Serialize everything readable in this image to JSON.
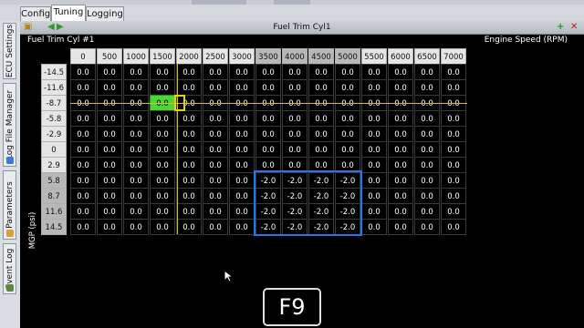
{
  "tabs": [
    {
      "label": "Config",
      "active": false
    },
    {
      "label": "Tuning",
      "active": true
    },
    {
      "label": "Logging",
      "active": false
    }
  ],
  "side_tabs": [
    "ECU Settings",
    "Log File Manager",
    "Parameters",
    "Event Log"
  ],
  "window": {
    "title": "Fuel Trim Cyl1",
    "left_icon": "folder-icon",
    "nav_icons": [
      "arrow-left-icon",
      "arrow-right-icon"
    ],
    "right_icons": [
      "plus-icon",
      "close-icon"
    ]
  },
  "table": {
    "name": "Fuel Trim Cyl #1",
    "x_axis_label": "Engine Speed (RPM)",
    "y_axis_label": "MGP (psi)",
    "columns": [
      "0",
      "500",
      "1000",
      "1500",
      "2000",
      "2500",
      "3000",
      "3500",
      "4000",
      "4500",
      "5000",
      "5500",
      "6000",
      "6500",
      "7000"
    ],
    "rows": [
      {
        "label": "-14.5",
        "values": [
          "0.0",
          "0.0",
          "0.0",
          "0.0",
          "0.0",
          "0.0",
          "0.0",
          "0.0",
          "0.0",
          "0.0",
          "0.0",
          "0.0",
          "0.0",
          "0.0",
          "0.0"
        ]
      },
      {
        "label": "-11.6",
        "values": [
          "0.0",
          "0.0",
          "0.0",
          "0.0",
          "0.0",
          "0.0",
          "0.0",
          "0.0",
          "0.0",
          "0.0",
          "0.0",
          "0.0",
          "0.0",
          "0.0",
          "0.0"
        ]
      },
      {
        "label": "-8.7",
        "values": [
          "0.0",
          "0.0",
          "0.0",
          "0.0",
          "0.0",
          "0.0",
          "0.0",
          "0.0",
          "0.0",
          "0.0",
          "0.0",
          "0.0",
          "0.0",
          "0.0",
          "0.0"
        ]
      },
      {
        "label": "-5.8",
        "values": [
          "0.0",
          "0.0",
          "0.0",
          "0.0",
          "0.0",
          "0.0",
          "0.0",
          "0.0",
          "0.0",
          "0.0",
          "0.0",
          "0.0",
          "0.0",
          "0.0",
          "0.0"
        ]
      },
      {
        "label": "-2.9",
        "values": [
          "0.0",
          "0.0",
          "0.0",
          "0.0",
          "0.0",
          "0.0",
          "0.0",
          "0.0",
          "0.0",
          "0.0",
          "0.0",
          "0.0",
          "0.0",
          "0.0",
          "0.0"
        ]
      },
      {
        "label": "0",
        "values": [
          "0.0",
          "0.0",
          "0.0",
          "0.0",
          "0.0",
          "0.0",
          "0.0",
          "0.0",
          "0.0",
          "0.0",
          "0.0",
          "0.0",
          "0.0",
          "0.0",
          "0.0"
        ]
      },
      {
        "label": "2.9",
        "values": [
          "0.0",
          "0.0",
          "0.0",
          "0.0",
          "0.0",
          "0.0",
          "0.0",
          "0.0",
          "0.0",
          "0.0",
          "0.0",
          "0.0",
          "0.0",
          "0.0",
          "0.0"
        ]
      },
      {
        "label": "5.8",
        "values": [
          "0.0",
          "0.0",
          "0.0",
          "0.0",
          "0.0",
          "0.0",
          "0.0",
          "-2.0",
          "-2.0",
          "-2.0",
          "-2.0",
          "0.0",
          "0.0",
          "0.0",
          "0.0"
        ]
      },
      {
        "label": "8.7",
        "values": [
          "0.0",
          "0.0",
          "0.0",
          "0.0",
          "0.0",
          "0.0",
          "0.0",
          "-2.0",
          "-2.0",
          "-2.0",
          "-2.0",
          "0.0",
          "0.0",
          "0.0",
          "0.0"
        ]
      },
      {
        "label": "11.6",
        "values": [
          "0.0",
          "0.0",
          "0.0",
          "0.0",
          "0.0",
          "0.0",
          "0.0",
          "-2.0",
          "-2.0",
          "-2.0",
          "-2.0",
          "0.0",
          "0.0",
          "0.0",
          "0.0"
        ]
      },
      {
        "label": "14.5",
        "values": [
          "0.0",
          "0.0",
          "0.0",
          "0.0",
          "0.0",
          "0.0",
          "0.0",
          "-2.0",
          "-2.0",
          "-2.0",
          "-2.0",
          "0.0",
          "0.0",
          "0.0",
          "0.0"
        ]
      }
    ],
    "highlighted_columns": [
      "3500",
      "4000",
      "4500",
      "5000"
    ],
    "highlighted_rows": [
      "5.8",
      "8.7",
      "11.6",
      "14.5"
    ],
    "active_cell": {
      "row": "-8.7",
      "col": "1500"
    },
    "selection": {
      "rows": [
        "5.8",
        "8.7",
        "11.6",
        "14.5"
      ],
      "cols": [
        "3500",
        "4000",
        "4500",
        "5000"
      ]
    }
  },
  "key_overlay": "F9",
  "colors": {
    "active_cell": "#4cd43a",
    "trace": "#d6c400",
    "selection": "#2277ee"
  }
}
